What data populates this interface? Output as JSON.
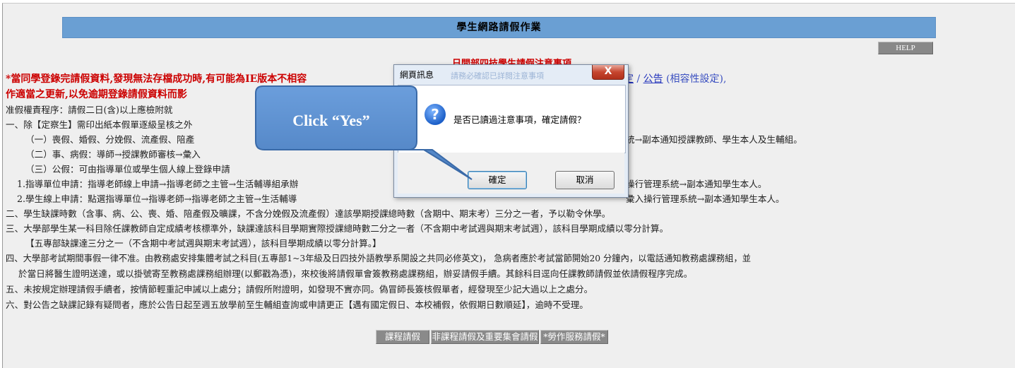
{
  "page": {
    "title": "學生網路請假作業",
    "help_label": "HELP",
    "notice_title": "日間部四技學生請假注意事項",
    "warning_line1": "*當同學登錄完請假資料,發現無法存檔成功時,有可能為IE版本不相容",
    "warning_line2": "作適當之更新,以免逾期登錄請假資料而影",
    "warning_right": {
      "link1": "定",
      "sep": " / ",
      "link2": "公告",
      "suffix": " (相容性設定),"
    }
  },
  "rules": {
    "r0": "准假權責程序：請假二日(含)以上應檢附就",
    "r1": "一、除【定察生】需印出紙本假單逐級呈核之外",
    "r2a": "（一）喪假、婚假、分娩假、流產假、陪產",
    "r2b": "統→副本通知授課教師、學生本人及生輔組。",
    "r3": "（二）事、病假：導師→授課教師審核→彙入",
    "r4": "（三）公假：可由指導單位或學生個人線上登錄申請",
    "r5a": "1.指導單位申請：指導老師線上申請→指導老師之主管→生活輔導組承辦",
    "r5b": "操行管理系統→副本通知學生本人。",
    "r6a": "2.學生線上申請：點選指導單位→指導老師→指導老師之主管→生活輔導",
    "r6b": "彙入操行管理系統→副本通知學生本人。",
    "r7": "二、學生缺課時數（含事、病、公、喪、婚、陪產假及曠課，不含分娩假及流產假）達該學期授課總時數（含期中、期末考）三分之一者，予以勒令休學。",
    "r8": "三、大學部學生某一科目除任課教師自定成績考核標準外，缺課達該科目學期實際授課總時數二分之一者（不含期中考試週與期末考試週），該科目學期成績以零分計算。",
    "r9": "【五專部缺課達三分之一（不含期中考試週與期末考試週），該科目學期成績以零分計算。】",
    "r10": "四、大學部考試期間事假一律不准。由教務處安排集體考試之科目(五專部1~3年級及日四技外語教學系開設之共同必修英文)， 急病者應於考試當節開始20 分鐘內，以電話通知教務處課務組，並",
    "r11": "於當日將醫生證明送達，或以掛號寄至教務處課務組辦理(以郵戳為憑)，來校後將請假單會簽教務處課務組，辦妥請假手續。其餘科目逕向任課教師請假並依請假程序完成。",
    "r12": "五、未按規定辦理請假手續者，按情節輕重記申誡以上處分；請假所附證明，如發現不實亦同。偽冒師長簽核假單者，經發現至少記大過以上之處分。",
    "r13": "六、對公告之缺課記錄有疑問者，應於公告日起至週五放學前至生輔組查詢或申請更正【遇有國定假日、本校補假，依假期日數順延】，逾時不受理。"
  },
  "buttons": {
    "course_leave": "課程請假",
    "noncourse_leave": "非課程請假及重要集會請假",
    "labor_leave": "*勞作服務請假*"
  },
  "dialog": {
    "title": "網頁訊息",
    "ghost_text": "請務必確認已詳閱注意事項",
    "close_glyph": "X",
    "icon_glyph": "?",
    "message": "是否已讀過注意事項，確定請假？",
    "ok_label": "確定",
    "cancel_label": "取消"
  },
  "callout": {
    "text": "Click “Yes”",
    "fill_color": "#5b8fd0"
  }
}
